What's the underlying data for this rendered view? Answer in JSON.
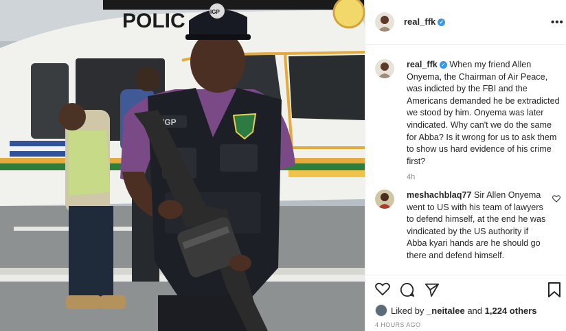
{
  "header": {
    "username": "real_ffk",
    "more_label": "•••"
  },
  "caption": {
    "username": "real_ffk",
    "text": "When my friend Allen Onyema, the Chairman of Air Peace, was indicted by the FBI and the Americans demanded he be extradicted we stood by him. Onyema was later vindicated. Why can't we do the same for Abba? Is it wrong for us to ask them to show us hard evidence of his crime first?",
    "time": "4h"
  },
  "comment": {
    "username": "meshachblaq77",
    "text": "Sir Allen Onyema went to US with his team of lawyers to defend himself, at the end he was vindicated by the US authority if Abba kyari hands are he should go there and defend himself."
  },
  "likes": {
    "prefix": "Liked by",
    "first_user": "_neitalee",
    "and": "and",
    "count": "1,224 others"
  },
  "timestamp": "4 HOURS AGO",
  "photo": {
    "helicopter_text": "POLIC",
    "cap_badge": "IGP",
    "vest_badge": "IGP"
  },
  "colors": {
    "verified": "#3897f0",
    "text": "#262626",
    "muted": "#8e8e8e",
    "border": "#efefef"
  },
  "icons": [
    "heart-icon",
    "comment-icon",
    "share-icon",
    "bookmark-icon",
    "more-icon",
    "verified-icon"
  ]
}
